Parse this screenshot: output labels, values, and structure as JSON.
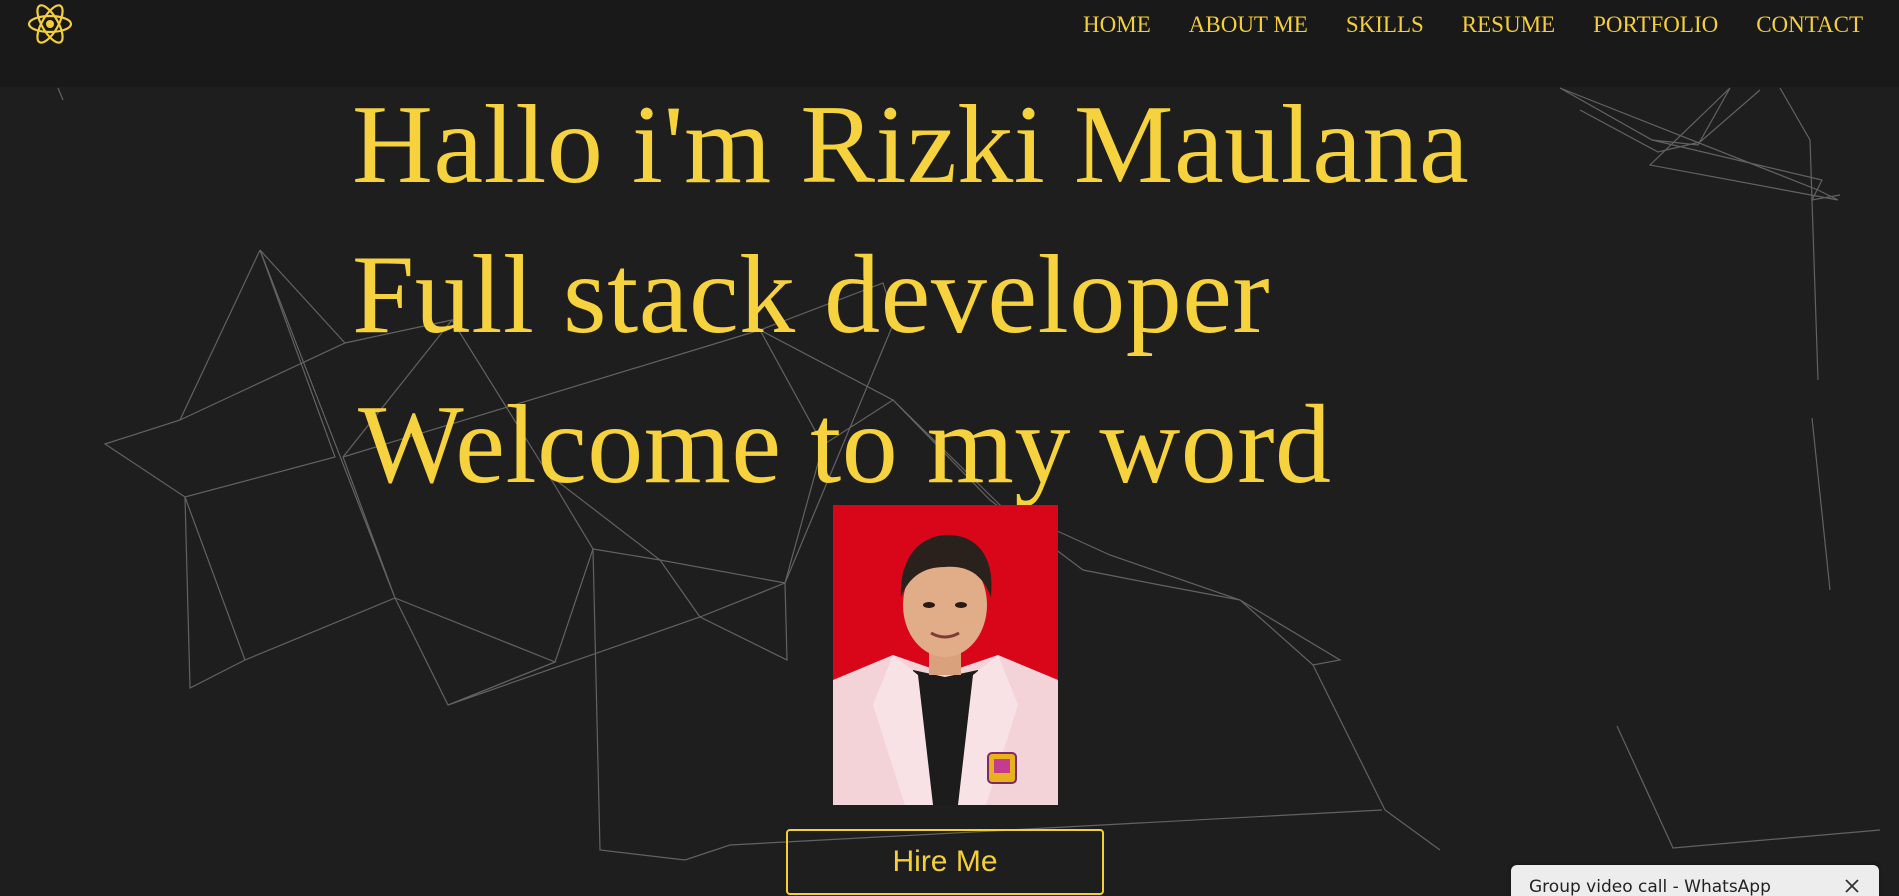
{
  "nav": {
    "items": [
      {
        "label": "HOME"
      },
      {
        "label": "ABOUT ME"
      },
      {
        "label": "SKILLS"
      },
      {
        "label": "RESUME"
      },
      {
        "label": "PORTFOLIO"
      },
      {
        "label": "CONTACT"
      }
    ]
  },
  "hero": {
    "line1": "Hallo i'm Rizki Maulana",
    "line2": "Full stack developer",
    "line3": "Welcome to my word",
    "photo_icon": "profile-photo",
    "hire_label": "Hire Me"
  },
  "notification": {
    "title": "Group video call - WhatsApp",
    "close_icon": "close-icon"
  },
  "colors": {
    "accent": "#f5cf3a",
    "background": "#1e1e1e",
    "navbar": "#191919",
    "photo_background": "#d9061a"
  },
  "logo_icon": "react-atom-icon"
}
